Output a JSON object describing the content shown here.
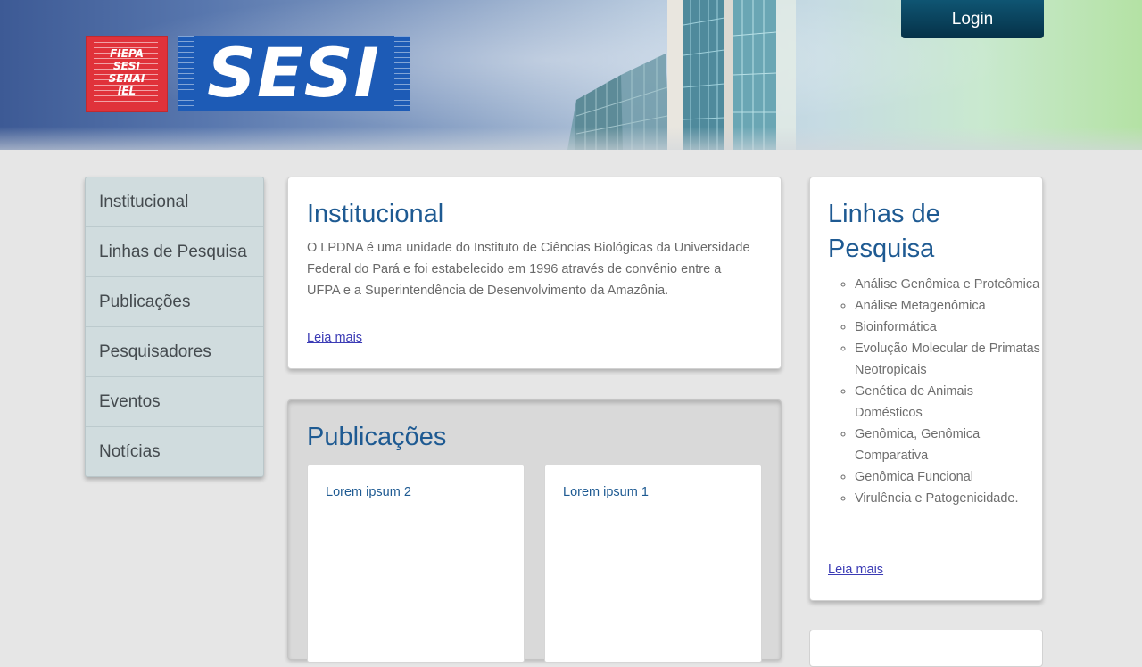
{
  "header": {
    "logo_red_lines": [
      "FIEPA",
      "SESI",
      "SENAI",
      "IEL"
    ],
    "logo_main": "SESI",
    "login_label": "Login"
  },
  "sidebar": {
    "items": [
      {
        "label": "Institucional"
      },
      {
        "label": "Linhas de Pesquisa"
      },
      {
        "label": "Publicações"
      },
      {
        "label": "Pesquisadores"
      },
      {
        "label": "Eventos"
      },
      {
        "label": "Notícias"
      }
    ]
  },
  "institucional": {
    "title": "Institucional",
    "text": "O LPDNA é uma unidade do Instituto de Ciências Biológicas da Universidade Federal do Pará e foi estabelecido em 1996 através de convênio entre a UFPA e a Superintendência de Desenvolvimento da Amazônia.",
    "read_more": "Leia mais"
  },
  "publicacoes": {
    "title": "Publicações",
    "items": [
      {
        "title": "Lorem ipsum 2"
      },
      {
        "title": "Lorem ipsum 1"
      }
    ]
  },
  "linhas": {
    "title": "Linhas de Pesquisa",
    "items": [
      "Análise Genômica e Proteômica",
      "Análise Metagenômica",
      "Bioinformática",
      "Evolução Molecular de Primatas Neotropicais",
      "Genética de Animais Domésticos",
      "Genômica, Genômica Comparativa",
      "Genômica Funcional",
      "Virulência e Patogenicidade."
    ],
    "read_more": "Leia mais"
  },
  "colors": {
    "title_blue": "#1e5a92",
    "login_bg": "#053148",
    "nav_bg": "#d0dcde",
    "logo_red": "#e0323a",
    "logo_blue": "#1d5bb6"
  }
}
